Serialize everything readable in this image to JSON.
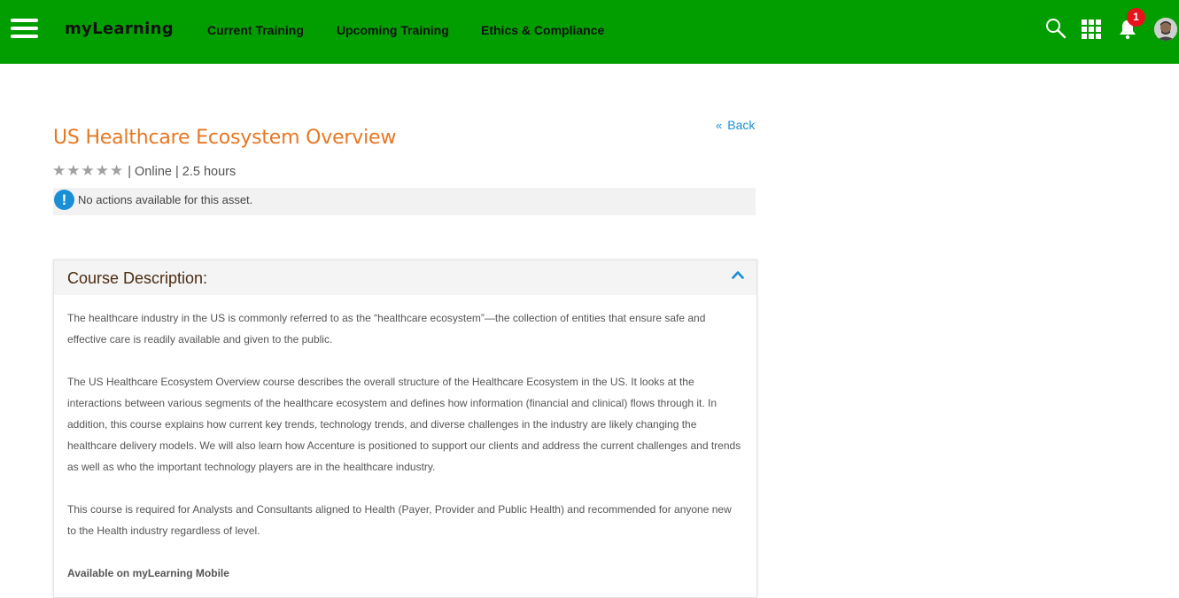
{
  "header": {
    "brand": "myLearning",
    "nav": [
      "Current Training",
      "Upcoming Training",
      "Ethics & Compliance"
    ],
    "notification_count": "1",
    "bg_color": "#029e00"
  },
  "page": {
    "title": "US Healthcare Ecosystem Overview",
    "back_label": "Back",
    "rating": {
      "stars_filled": 0,
      "stars_total": 5,
      "glyphs": "★★★★★"
    },
    "meta_text": " | Online | 2.5 hours",
    "notice": "No actions available for this asset.",
    "notice_icon": "!"
  },
  "course": {
    "heading": "Course Description:",
    "paragraphs": [
      "The healthcare industry in the US is commonly referred to as the “healthcare ecosystem”—the collection of entities that ensure safe and effective care is readily available and given to the public.",
      "The US Healthcare Ecosystem Overview course describes the overall structure of the Healthcare Ecosystem in the US. It looks at the interactions between various segments of the healthcare ecosystem and defines how information (financial and clinical) flows through it. In addition, this course explains how current key trends, technology trends, and diverse challenges in the industry are likely changing the healthcare delivery models. We will also learn how Accenture is positioned to support our clients and address the current challenges and trends as well as who the important technology players are in the healthcare industry.",
      "This course is required for Analysts and Consultants aligned to Health (Payer, Provider and Public Health) and recommended for anyone new to the Health industry regardless of level.",
      "Available on myLearning Mobile"
    ]
  },
  "colors": {
    "accent_title": "#e87722",
    "link": "#1a8fd6",
    "badge": "#e8121a"
  }
}
